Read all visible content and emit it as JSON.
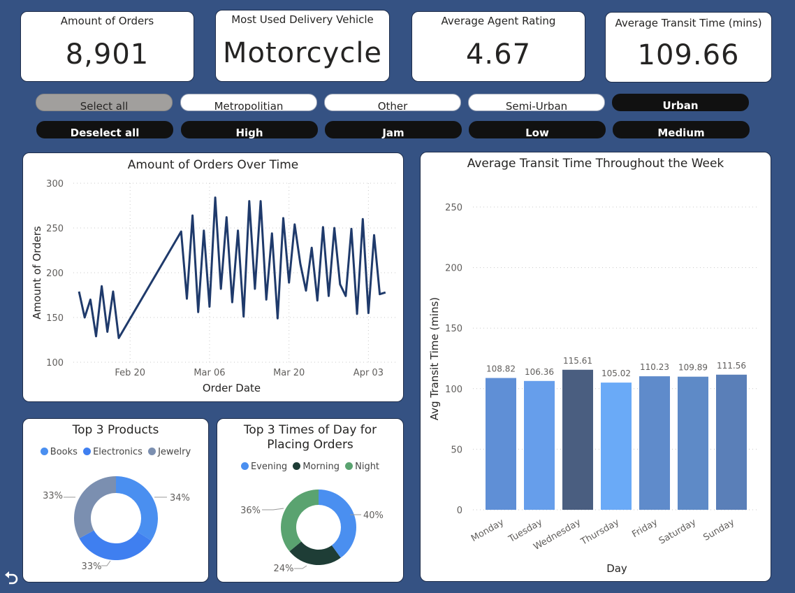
{
  "kpis": [
    {
      "label": "Amount of Orders",
      "value": "8,901"
    },
    {
      "label": "Most Used Delivery Vehicle",
      "value": "Motorcycle"
    },
    {
      "label": "Average Agent Rating",
      "value": "4.67"
    },
    {
      "label": "Average Transit Time (mins)",
      "value": "109.66"
    }
  ],
  "slicer_area": [
    "Select all",
    "Metropolitian",
    "Other",
    "Semi-Urban",
    "Urban"
  ],
  "slicer_traffic": [
    "Deselect all",
    "High",
    "Jam",
    "Low",
    "Medium"
  ],
  "colors": {
    "accent": "#1f3a6b",
    "background": "#355283"
  },
  "chart_data": [
    {
      "type": "line",
      "title": "Amount of Orders Over Time",
      "xlabel": "Order Date",
      "ylabel": "Amount of Orders",
      "yticks": [
        "100",
        "150",
        "200",
        "250",
        "300"
      ],
      "xticks": [
        "Feb 20",
        "Mar 06",
        "Mar 20",
        "Apr 03"
      ],
      "ylim": [
        100,
        300
      ],
      "x": [
        "2022-02-11",
        "2022-02-12",
        "2022-02-13",
        "2022-02-14",
        "2022-02-15",
        "2022-02-16",
        "2022-02-17",
        "2022-02-18",
        "2022-03-01",
        "2022-03-02",
        "2022-03-03",
        "2022-03-04",
        "2022-03-05",
        "2022-03-06",
        "2022-03-07",
        "2022-03-08",
        "2022-03-09",
        "2022-03-10",
        "2022-03-11",
        "2022-03-12",
        "2022-03-13",
        "2022-03-14",
        "2022-03-15",
        "2022-03-16",
        "2022-03-17",
        "2022-03-18",
        "2022-03-19",
        "2022-03-20",
        "2022-03-21",
        "2022-03-22",
        "2022-03-23",
        "2022-03-24",
        "2022-03-25",
        "2022-03-26",
        "2022-03-27",
        "2022-03-28",
        "2022-03-29",
        "2022-03-30",
        "2022-03-31",
        "2022-04-01",
        "2022-04-02",
        "2022-04-03",
        "2022-04-04",
        "2022-04-05",
        "2022-04-06"
      ],
      "values": [
        179,
        150,
        170,
        129,
        185,
        134,
        179,
        127,
        246,
        171,
        264,
        156,
        247,
        162,
        284,
        182,
        262,
        167,
        247,
        151,
        280,
        182,
        280,
        170,
        244,
        149,
        261,
        189,
        254,
        210,
        180,
        228,
        169,
        251,
        174,
        250,
        187,
        174,
        249,
        154,
        260,
        155,
        242,
        176,
        178
      ],
      "line_color": "#1f3a6b"
    },
    {
      "type": "bar",
      "title": "Average Transit Time Throughout the Week",
      "xlabel": "Day",
      "ylabel": "Avg Transit Time (mins)",
      "categories": [
        "Monday",
        "Tuesday",
        "Wednesday",
        "Thursday",
        "Friday",
        "Saturday",
        "Sunday"
      ],
      "values": [
        108.82,
        106.36,
        115.61,
        105.02,
        110.23,
        109.89,
        111.56
      ],
      "value_labels": [
        "108.82",
        "106.36",
        "115.61",
        "105.02",
        "110.23",
        "109.89",
        "111.56"
      ],
      "yticks": [
        "0",
        "50",
        "100",
        "150",
        "200",
        "250"
      ],
      "ylim": [
        0,
        250
      ],
      "bar_colors": [
        "#5f8fd6",
        "#669eeb",
        "#4a5e80",
        "#6aaaf7",
        "#5f8bcb",
        "#5e8ac7",
        "#5a7fb8"
      ]
    },
    {
      "type": "pie",
      "title": "Top 3 Products",
      "labels": [
        "Books",
        "Electronics",
        "Jewelry"
      ],
      "values": [
        34,
        33,
        33
      ],
      "percent_labels": [
        "34%",
        "33%",
        "33%"
      ],
      "colors": [
        "#4a8ff0",
        "#3f7ff0",
        "#7b8fb0"
      ]
    },
    {
      "type": "pie",
      "title": "Top 3 Times of Day for Placing Orders",
      "labels": [
        "Evening",
        "Morning",
        "Night"
      ],
      "values": [
        40,
        24,
        36
      ],
      "percent_labels": [
        "40%",
        "24%",
        "36%"
      ],
      "colors": [
        "#4a8ff0",
        "#1e3d36",
        "#5aa370"
      ]
    }
  ]
}
